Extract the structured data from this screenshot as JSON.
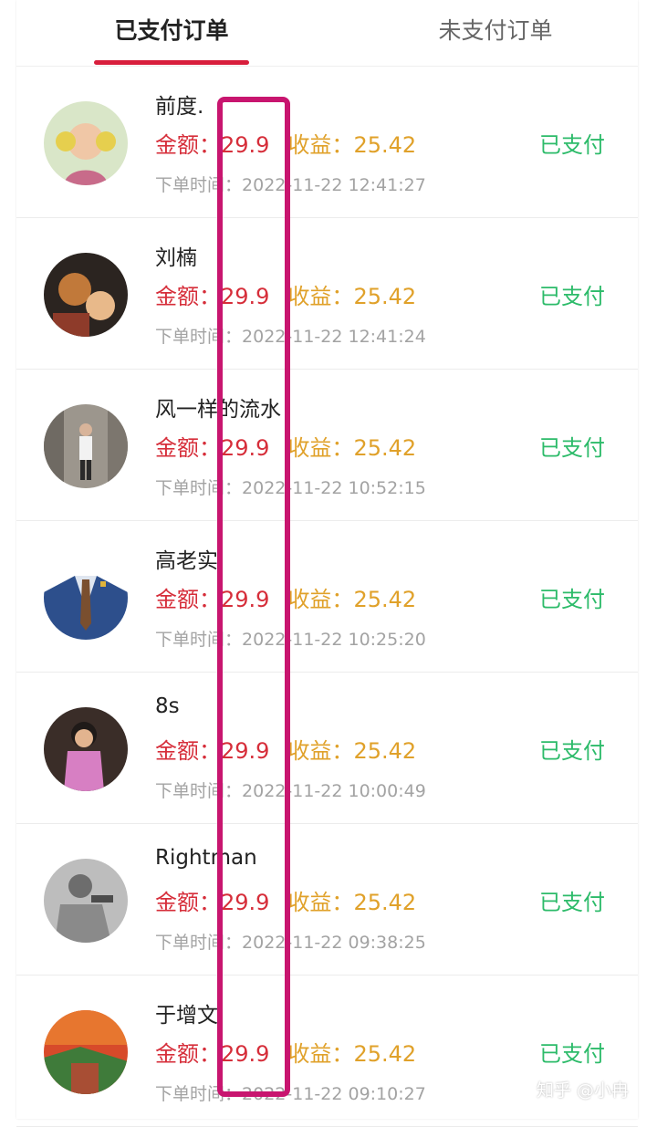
{
  "tabs": [
    {
      "label": "已支付订单",
      "active": true
    },
    {
      "label": "未支付订单",
      "active": false
    }
  ],
  "colors": {
    "accent": "#d81e3c",
    "amount": "#d62e3a",
    "income": "#e0a12a",
    "status": "#2dbb6a",
    "highlight_box": "#c8156f"
  },
  "labels": {
    "amount": "金额：",
    "income": "收益：",
    "order_time": "下单时间："
  },
  "orders": [
    {
      "name": "前度.",
      "amount": "29.9",
      "income": "25.42",
      "time": "2022-11-22 12:41:27",
      "status": "已支付"
    },
    {
      "name": "刘楠",
      "amount": "29.9",
      "income": "25.42",
      "time": "2022-11-22 12:41:24",
      "status": "已支付"
    },
    {
      "name": "风一样的流水",
      "amount": "29.9",
      "income": "25.42",
      "time": "2022-11-22 10:52:15",
      "status": "已支付"
    },
    {
      "name": "高老实",
      "amount": "29.9",
      "income": "25.42",
      "time": "2022-11-22 10:25:20",
      "status": "已支付"
    },
    {
      "name": "8s",
      "amount": "29.9",
      "income": "25.42",
      "time": "2022-11-22 10:00:49",
      "status": "已支付"
    },
    {
      "name": "Rightman",
      "amount": "29.9",
      "income": "25.42",
      "time": "2022-11-22 09:38:25",
      "status": "已支付"
    },
    {
      "name": "于增文",
      "amount": "29.9",
      "income": "25.42",
      "time": "2022-11-22 09:10:27",
      "status": "已支付"
    }
  ],
  "watermark": "知乎 @小冉"
}
